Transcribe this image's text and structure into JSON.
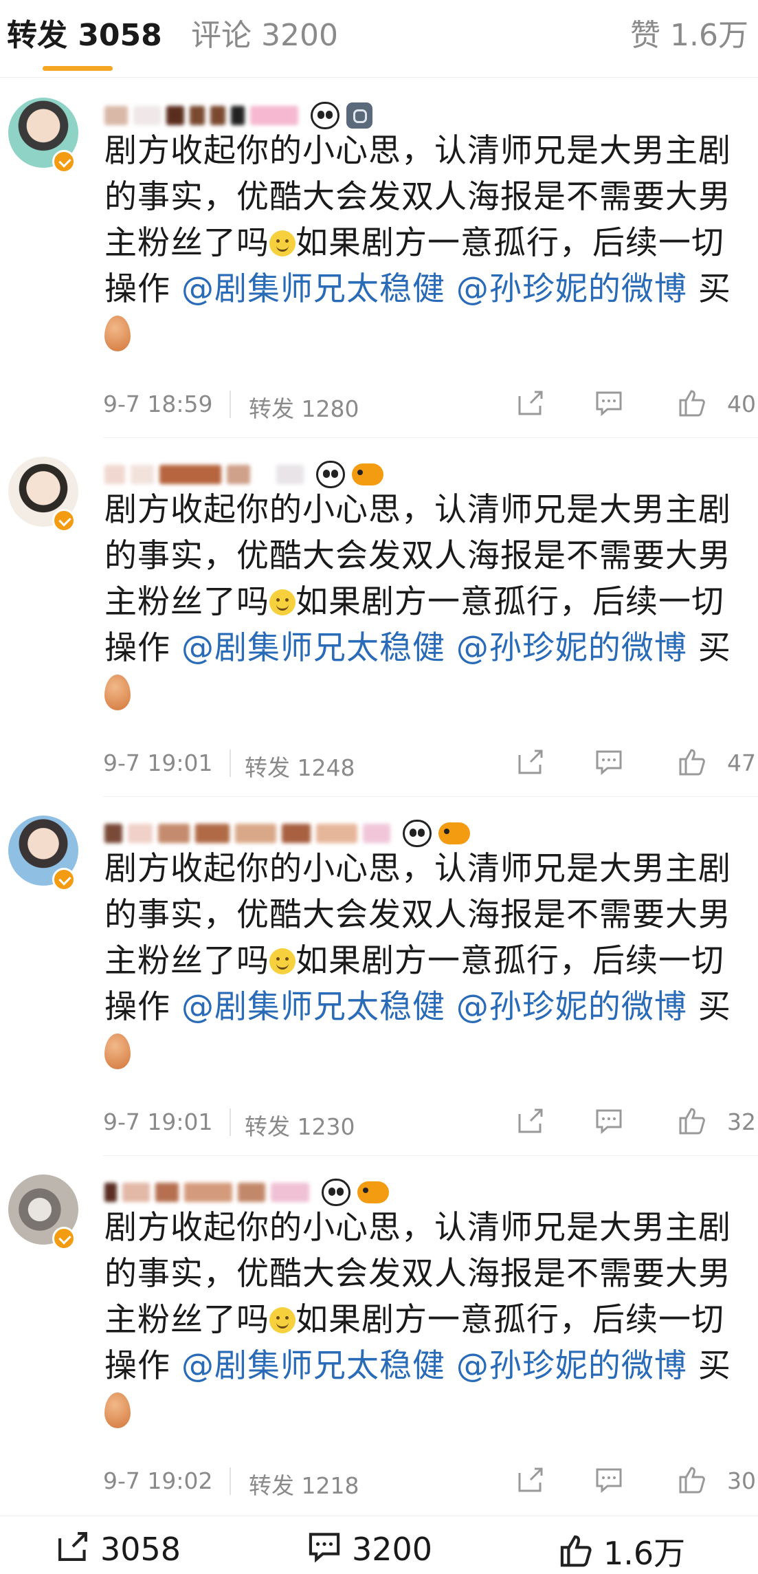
{
  "tabs": {
    "reposts": "转发 3058",
    "comments": "评论 3200",
    "likes": "赞 1.6万"
  },
  "post_text": {
    "line1": "剧方收起你的小心思，认清师兄是大男主剧",
    "line2": "的事实，优酷大会发双人海报是不需要大男",
    "line3a": "主粉丝了吗",
    "line3b": "如果剧方一意孤行，后续一切",
    "line4a": "操作 ",
    "mention1": "@剧集师兄太稳健",
    "mention2": "@孙珍妮的微博",
    "line4b": " 买"
  },
  "posts": [
    {
      "time": "9-7 18:59",
      "reposts": "转发 1280",
      "likes": "40"
    },
    {
      "time": "9-7 19:01",
      "reposts": "转发 1248",
      "likes": "47"
    },
    {
      "time": "9-7 19:01",
      "reposts": "转发 1230",
      "likes": "32"
    },
    {
      "time": "9-7 19:02",
      "reposts": "转发 1218",
      "likes": "30"
    }
  ],
  "bottom_bar": {
    "reposts": "3058",
    "comments": "3200",
    "likes": "1.6万"
  },
  "colors": {
    "accent": "#f5a623",
    "mention": "#2a6bb8",
    "verified": "#f39c12"
  },
  "icons": [
    "share-icon",
    "comment-icon",
    "thumbs-up-icon",
    "panda-icon",
    "fish-icon",
    "camera-icon",
    "smile-emoji",
    "egg-emoji",
    "verified-icon"
  ]
}
